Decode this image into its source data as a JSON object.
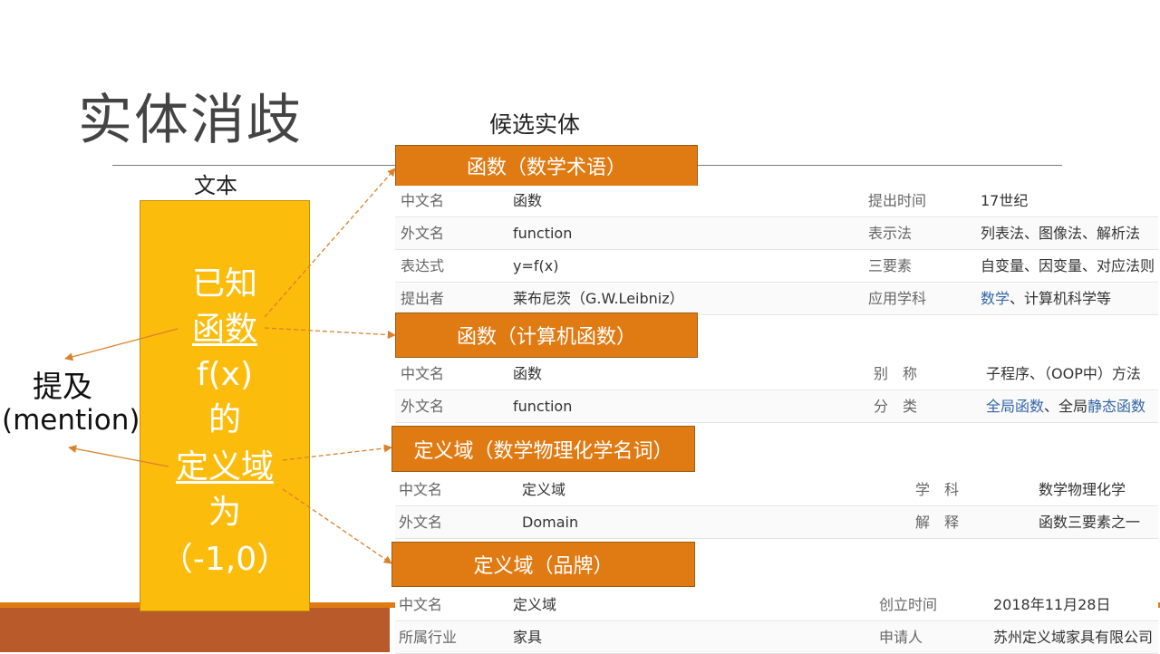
{
  "slide": {
    "title": "实体消歧",
    "candidate_label": "候选实体",
    "text_label": "文本",
    "mention_label_1": "提及",
    "mention_label_2": "(mention)"
  },
  "text_panel": {
    "lines": [
      "已知",
      "函数",
      "f(x)",
      "的",
      "定义域",
      "为",
      "（-1,0）"
    ]
  },
  "entities": [
    {
      "title": "函数（数学术语）",
      "rows": [
        [
          "中文名",
          "函数",
          "提出时间",
          "17世纪"
        ],
        [
          "外文名",
          "function",
          "表示法",
          "列表法、图像法、解析法"
        ],
        [
          "表达式",
          "y=f(x)",
          "三要素",
          "自变量、因变量、对应法则"
        ],
        [
          "提出者",
          "莱布尼茨（G.W.Leibniz）",
          "应用学科",
          "、计算机科学等"
        ]
      ],
      "link_text": "数学"
    },
    {
      "title": "函数（计算机函数）",
      "rows": [
        [
          "中文名",
          "函数",
          "别　称",
          "子程序、（OOP中）方法"
        ],
        [
          "外文名",
          "function",
          "分　类",
          "、全局"
        ]
      ],
      "links": [
        "全局函数",
        "静态函数"
      ]
    },
    {
      "title": "定义域（数学物理化学名词）",
      "rows": [
        [
          "中文名",
          "定义域",
          "学　科",
          "数学物理化学"
        ],
        [
          "外文名",
          "Domain",
          "解　释",
          "函数三要素之一"
        ]
      ]
    },
    {
      "title": "定义域（品牌）",
      "rows": [
        [
          "中文名",
          "定义域",
          "创立时间",
          "2018年11月28日"
        ],
        [
          "所属行业",
          "家具",
          "申请人",
          "苏州定义域家具有限公司"
        ]
      ]
    }
  ],
  "colors": {
    "orange": "#e07b14",
    "yellow": "#fcbc0c",
    "brown": "#b85a2a",
    "link": "#3366aa"
  }
}
